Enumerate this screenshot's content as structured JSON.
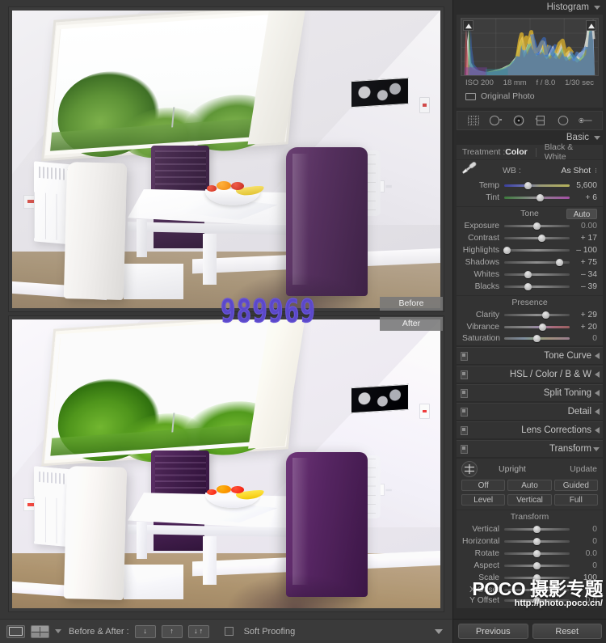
{
  "histogram": {
    "title": "Histogram",
    "iso": "ISO 200",
    "focal": "18 mm",
    "aperture": "f / 8.0",
    "shutter": "1/30 sec",
    "original_photo_label": "Original Photo"
  },
  "toolstrip": {
    "tools": [
      "crop-overlay-icon",
      "spot-removal-icon",
      "red-eye-icon",
      "graduated-filter-icon",
      "radial-filter-icon",
      "adjustment-brush-icon"
    ]
  },
  "basic": {
    "title": "Basic",
    "treatment_label": "Treatment :",
    "treatment_color": "Color",
    "treatment_bw": "Black & White",
    "wb_label": "WB :",
    "wb_value": "As Shot",
    "tone_label": "Tone",
    "auto_label": "Auto",
    "presence_label": "Presence",
    "sliders": [
      {
        "label": "Temp",
        "value": "5,600",
        "pos": 36,
        "style": "temp"
      },
      {
        "label": "Tint",
        "value": "+ 6",
        "pos": 55,
        "style": "tint"
      },
      {
        "label": "Exposure",
        "value": "0.00",
        "pos": 50,
        "style": "flat"
      },
      {
        "label": "Contrast",
        "value": "+ 17",
        "pos": 57,
        "style": "flat"
      },
      {
        "label": "Highlights",
        "value": "– 100",
        "pos": 4,
        "style": "flat"
      },
      {
        "label": "Shadows",
        "value": "+ 75",
        "pos": 85,
        "style": "flat"
      },
      {
        "label": "Whites",
        "value": "– 34",
        "pos": 37,
        "style": "flat"
      },
      {
        "label": "Blacks",
        "value": "– 39",
        "pos": 36,
        "style": "flat"
      },
      {
        "label": "Clarity",
        "value": "+ 29",
        "pos": 63,
        "style": "flat"
      },
      {
        "label": "Vibrance",
        "value": "+ 20",
        "pos": 59,
        "style": "vib"
      },
      {
        "label": "Saturation",
        "value": "0",
        "pos": 50,
        "style": "sat"
      }
    ]
  },
  "collapsed_panels": [
    {
      "title": "Tone Curve",
      "arrow": "left"
    },
    {
      "title": "HSL  /  Color  /  B & W",
      "arrow": "left"
    },
    {
      "title": "Split Toning",
      "arrow": "left"
    },
    {
      "title": "Detail",
      "arrow": "left"
    },
    {
      "title": "Lens Corrections",
      "arrow": "left"
    },
    {
      "title": "Transform",
      "arrow": "down"
    }
  ],
  "transform": {
    "upright_label": "Upright",
    "update_label": "Update",
    "buttons_row1": [
      "Off",
      "Auto",
      "Guided"
    ],
    "buttons_row2": [
      "Level",
      "Vertical",
      "Full"
    ],
    "section_label": "Transform",
    "sliders": [
      {
        "label": "Vertical",
        "value": "0",
        "pos": 50
      },
      {
        "label": "Horizontal",
        "value": "0",
        "pos": 50
      },
      {
        "label": "Rotate",
        "value": "0.0",
        "pos": 50
      },
      {
        "label": "Aspect",
        "value": "0",
        "pos": 50
      },
      {
        "label": "Scale",
        "value": "100",
        "pos": 50
      },
      {
        "label": "X Offset",
        "value": "0.0",
        "pos": 50
      },
      {
        "label": "Y Offset",
        "value": "0.0",
        "pos": 50
      }
    ]
  },
  "bottom_buttons": {
    "previous": "Previous",
    "reset": "Reset"
  },
  "toolbar": {
    "before_after_label": "Before & After :",
    "soft_proofing_label": "Soft Proofing"
  },
  "viewer": {
    "before_label": "Before",
    "after_label": "After",
    "watermark_digits": "989969"
  },
  "watermark": {
    "brand": "POCO 摄影专题",
    "url": "http://photo.poco.cn/"
  },
  "colors": {
    "panel_bg": "#2b2b2b",
    "section_bg": "#333333",
    "text": "#bdbdbd",
    "accent": "#e8e8e8",
    "watermark_purple": "#5b48c9"
  }
}
